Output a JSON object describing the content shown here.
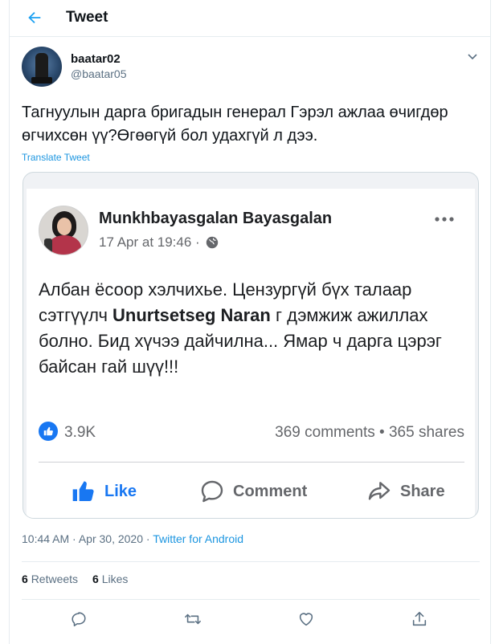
{
  "header": {
    "title": "Tweet"
  },
  "tweet": {
    "author_name": "baatar02",
    "author_handle": "@baatar05",
    "text": "Тагнуулын дарга бригадын генерал Гэрэл ажлаа өчигдөр өгчихсөн үү?Өгөөгүй бол удахгүй л дээ.",
    "translate_label": "Translate Tweet",
    "time": "10:44 AM · Apr 30, 2020 · ",
    "source": "Twitter for Android",
    "retweets_count": "6",
    "retweets_label": "Retweets",
    "likes_count": "6",
    "likes_label": "Likes"
  },
  "fb_post": {
    "author": "Munkhbayasgalan Bayasgalan",
    "date": "17 Apr at 19:46 ·",
    "text_before": "Албан ёсоор хэлчихье. Цензургүй бүх талаар сэтгүүлч ",
    "text_bold": "Unurtsetseg Naran",
    "text_after": " г дэмжиж ажиллах болно.  Бид хүчээ дайчилна... Ямар ч дарга цэрэг байсан гай шүү!!!",
    "like_count": "3.9K",
    "comments_shares": "369 comments • 365 shares",
    "like_label": "Like",
    "comment_label": "Comment",
    "share_label": "Share"
  },
  "colors": {
    "twitter_blue": "#1da1f2",
    "facebook_blue": "#1877f2",
    "muted_text": "#5b7083"
  },
  "icons": [
    "back-arrow-icon",
    "chevron-down-icon",
    "globe-icon",
    "more-dots-icon",
    "thumbs-up-icon",
    "comment-icon",
    "share-arrow-icon",
    "reply-icon",
    "retweet-icon",
    "heart-icon",
    "share-icon"
  ]
}
